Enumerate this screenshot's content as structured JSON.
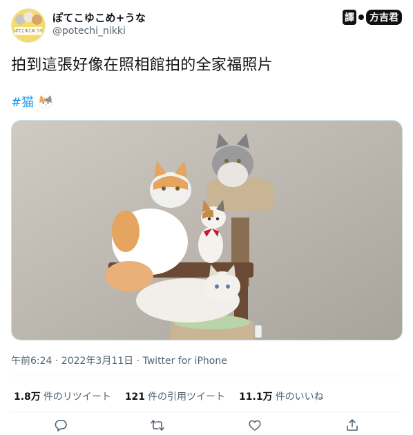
{
  "author": {
    "display_name": "ぽてこゆこめ+うな",
    "handle": "@potechi_nikki",
    "avatar_caption": "ぽてこゆこめ うな"
  },
  "translator_badge": {
    "left": "譯",
    "right": "方吉君"
  },
  "tweet": {
    "text": "拍到這張好像在照相館拍的全家福照片",
    "hashtag": "#猫",
    "emoji": "cat-face-emoji",
    "photo_icon": "cat-family-photo"
  },
  "timestamp": "午前6:24 · 2022年3月11日 · Twitter for iPhone",
  "stats": [
    {
      "value": "1.8万",
      "label": "件のリツイート"
    },
    {
      "value": "121",
      "label": "件の引用ツイート"
    },
    {
      "value": "11.1万",
      "label": "件のいいね"
    }
  ],
  "actions": {
    "reply_icon": "reply-icon",
    "retweet_icon": "retweet-icon",
    "like_icon": "like-icon",
    "share_icon": "share-icon"
  },
  "colors": {
    "accent": "#1d9bf0",
    "secondary_text": "#536471",
    "divider": "#eff3f4"
  }
}
